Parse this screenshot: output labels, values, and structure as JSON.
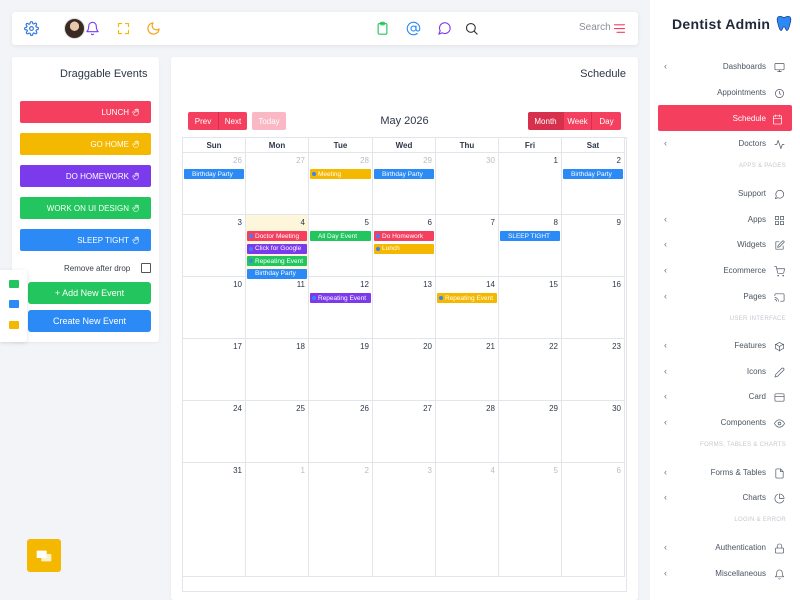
{
  "topbar": {
    "icons": [
      "gear-icon",
      "avatar",
      "bell-icon",
      "fullscreen-icon",
      "moon-icon",
      "clipboard-icon",
      "at-icon",
      "chat-icon",
      "search-icon",
      "menu-icon"
    ],
    "search_label": "Search"
  },
  "left": {
    "title": "Draggable Events",
    "events": [
      {
        "label": "LUNCH",
        "color": "#f43f5e"
      },
      {
        "label": "GO HOME",
        "color": "#f5b800"
      },
      {
        "label": "DO HOMEWORK",
        "color": "#7c3aed"
      },
      {
        "label": "WORK ON UI DESIGN",
        "color": "#22c55e"
      },
      {
        "label": "SLEEP TIGHT",
        "color": "#2b8af6"
      }
    ],
    "remove_label": "Remove after drop",
    "add_button": "+ Add New Event",
    "create_button": "Create New Event"
  },
  "schedule": {
    "title": "Schedule",
    "prev": "Prev",
    "next": "Next",
    "today": "Today",
    "month_title": "May 2026",
    "views": [
      "Month",
      "Week",
      "Day"
    ],
    "days_of_week": [
      "Sun",
      "Mon",
      "Tue",
      "Wed",
      "Thu",
      "Fri",
      "Sat"
    ],
    "weeks": [
      [
        {
          "d": "26",
          "o": true
        },
        {
          "d": "27",
          "o": true
        },
        {
          "d": "28",
          "o": true
        },
        {
          "d": "29",
          "o": true
        },
        {
          "d": "30",
          "o": true
        },
        {
          "d": "1"
        },
        {
          "d": "2"
        }
      ],
      [
        {
          "d": "3"
        },
        {
          "d": "4",
          "today": true
        },
        {
          "d": "5"
        },
        {
          "d": "6"
        },
        {
          "d": "7"
        },
        {
          "d": "8"
        },
        {
          "d": "9"
        }
      ],
      [
        {
          "d": "10"
        },
        {
          "d": "11"
        },
        {
          "d": "12"
        },
        {
          "d": "13"
        },
        {
          "d": "14"
        },
        {
          "d": "15"
        },
        {
          "d": "16"
        }
      ],
      [
        {
          "d": "17"
        },
        {
          "d": "18"
        },
        {
          "d": "19"
        },
        {
          "d": "20"
        },
        {
          "d": "21"
        },
        {
          "d": "22"
        },
        {
          "d": "23"
        }
      ],
      [
        {
          "d": "24"
        },
        {
          "d": "25"
        },
        {
          "d": "26"
        },
        {
          "d": "27"
        },
        {
          "d": "28"
        },
        {
          "d": "29"
        },
        {
          "d": "30"
        }
      ],
      [
        {
          "d": "31"
        },
        {
          "d": "1",
          "o": true
        },
        {
          "d": "2",
          "o": true
        },
        {
          "d": "3",
          "o": true
        },
        {
          "d": "4",
          "o": true
        },
        {
          "d": "5",
          "o": true
        },
        {
          "d": "6",
          "o": true
        }
      ]
    ],
    "events": [
      {
        "week": 0,
        "day": 0,
        "slot": 0,
        "label": "Birthday Party",
        "color": "#2b8af6",
        "dot": false
      },
      {
        "week": 0,
        "day": 2,
        "slot": 0,
        "label": "Meeting",
        "color": "#f5b800",
        "dot": true
      },
      {
        "week": 0,
        "day": 3,
        "slot": 0,
        "label": "Birthday Party",
        "color": "#2b8af6",
        "dot": false
      },
      {
        "week": 0,
        "day": 6,
        "slot": 0,
        "label": "Birthday Party",
        "color": "#2b8af6",
        "dot": false
      },
      {
        "week": 1,
        "day": 1,
        "slot": 0,
        "label": "Doctor Meeting",
        "color": "#f43f5e",
        "dot": true
      },
      {
        "week": 1,
        "day": 1,
        "slot": 1,
        "label": "Click for Google",
        "color": "#7c3aed",
        "dot": true
      },
      {
        "week": 1,
        "day": 1,
        "slot": 2,
        "label": "Repeating Event",
        "color": "#22c55e",
        "dot": true
      },
      {
        "week": 1,
        "day": 1,
        "slot": 3,
        "label": "Birthday Party",
        "color": "#2b8af6",
        "dot": false
      },
      {
        "week": 1,
        "day": 2,
        "slot": 0,
        "label": "All Day Event",
        "color": "#22c55e",
        "dot": false
      },
      {
        "week": 1,
        "day": 3,
        "slot": 0,
        "label": "Do Homework",
        "color": "#f43f5e",
        "dot": true
      },
      {
        "week": 1,
        "day": 3,
        "slot": 1,
        "label": "Lunch",
        "color": "#f5b800",
        "dot": true
      },
      {
        "week": 1,
        "day": 5,
        "slot": 0,
        "label": "SLEEP TIGHT",
        "color": "#2b8af6",
        "dot": false
      },
      {
        "week": 2,
        "day": 2,
        "slot": 0,
        "label": "Repeating Event",
        "color": "#7c3aed",
        "dot": true
      },
      {
        "week": 2,
        "day": 4,
        "slot": 0,
        "label": "Repeating Event",
        "color": "#f5b800",
        "dot": true
      }
    ]
  },
  "sidebar": {
    "brand": "Dentist Admin",
    "items": [
      {
        "label": "Dashboards",
        "icon": "monitor-icon",
        "chev": true
      },
      {
        "label": "Appointments",
        "icon": "clock-icon",
        "chev": false
      },
      {
        "label": "Schedule",
        "icon": "calendar-icon",
        "chev": false,
        "active": true
      },
      {
        "label": "Doctors",
        "icon": "pulse-icon",
        "chev": true
      },
      {
        "section": "APPS & PAGES"
      },
      {
        "label": "Support",
        "icon": "chat-bubble-icon",
        "chev": false
      },
      {
        "label": "Apps",
        "icon": "grid-icon",
        "chev": true
      },
      {
        "label": "Widgets",
        "icon": "edit-icon",
        "chev": true
      },
      {
        "label": "Ecommerce",
        "icon": "cart-icon",
        "chev": true
      },
      {
        "label": "Pages",
        "icon": "cast-icon",
        "chev": true
      },
      {
        "section": "USER INTERFACE"
      },
      {
        "label": "Features",
        "icon": "box-icon",
        "chev": true
      },
      {
        "label": "Icons",
        "icon": "pencil-icon",
        "chev": true
      },
      {
        "label": "Card",
        "icon": "card-icon",
        "chev": true
      },
      {
        "label": "Components",
        "icon": "eye-icon",
        "chev": true
      },
      {
        "section": "FORMS, TABLES & CHARTS"
      },
      {
        "label": "Forms & Tables",
        "icon": "file-icon",
        "chev": true
      },
      {
        "label": "Charts",
        "icon": "pie-icon",
        "chev": true
      },
      {
        "section": "LOGIN & ERROR"
      },
      {
        "label": "Authentication",
        "icon": "lock-icon",
        "chev": true
      },
      {
        "label": "Miscellaneous",
        "icon": "bell-icon",
        "chev": true
      }
    ]
  }
}
